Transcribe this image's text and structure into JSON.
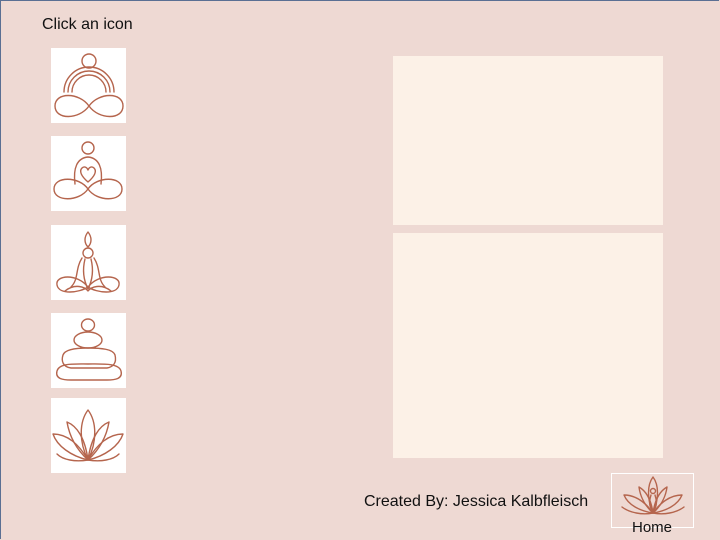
{
  "prompt": "Click an icon",
  "icons": [
    {
      "name": "meditation-rainbow-icon"
    },
    {
      "name": "meditation-heart-icon"
    },
    {
      "name": "meditation-raised-arms-icon"
    },
    {
      "name": "stacked-stones-icon"
    },
    {
      "name": "lotus-flower-icon"
    }
  ],
  "credit": "Created By: Jessica Kalbfleisch",
  "home": {
    "label": "Home"
  },
  "colors": {
    "background": "#eed9d3",
    "panel": "#fcf1e7",
    "icon_stroke": "#b5654d",
    "icon_tile": "#ffffff"
  }
}
